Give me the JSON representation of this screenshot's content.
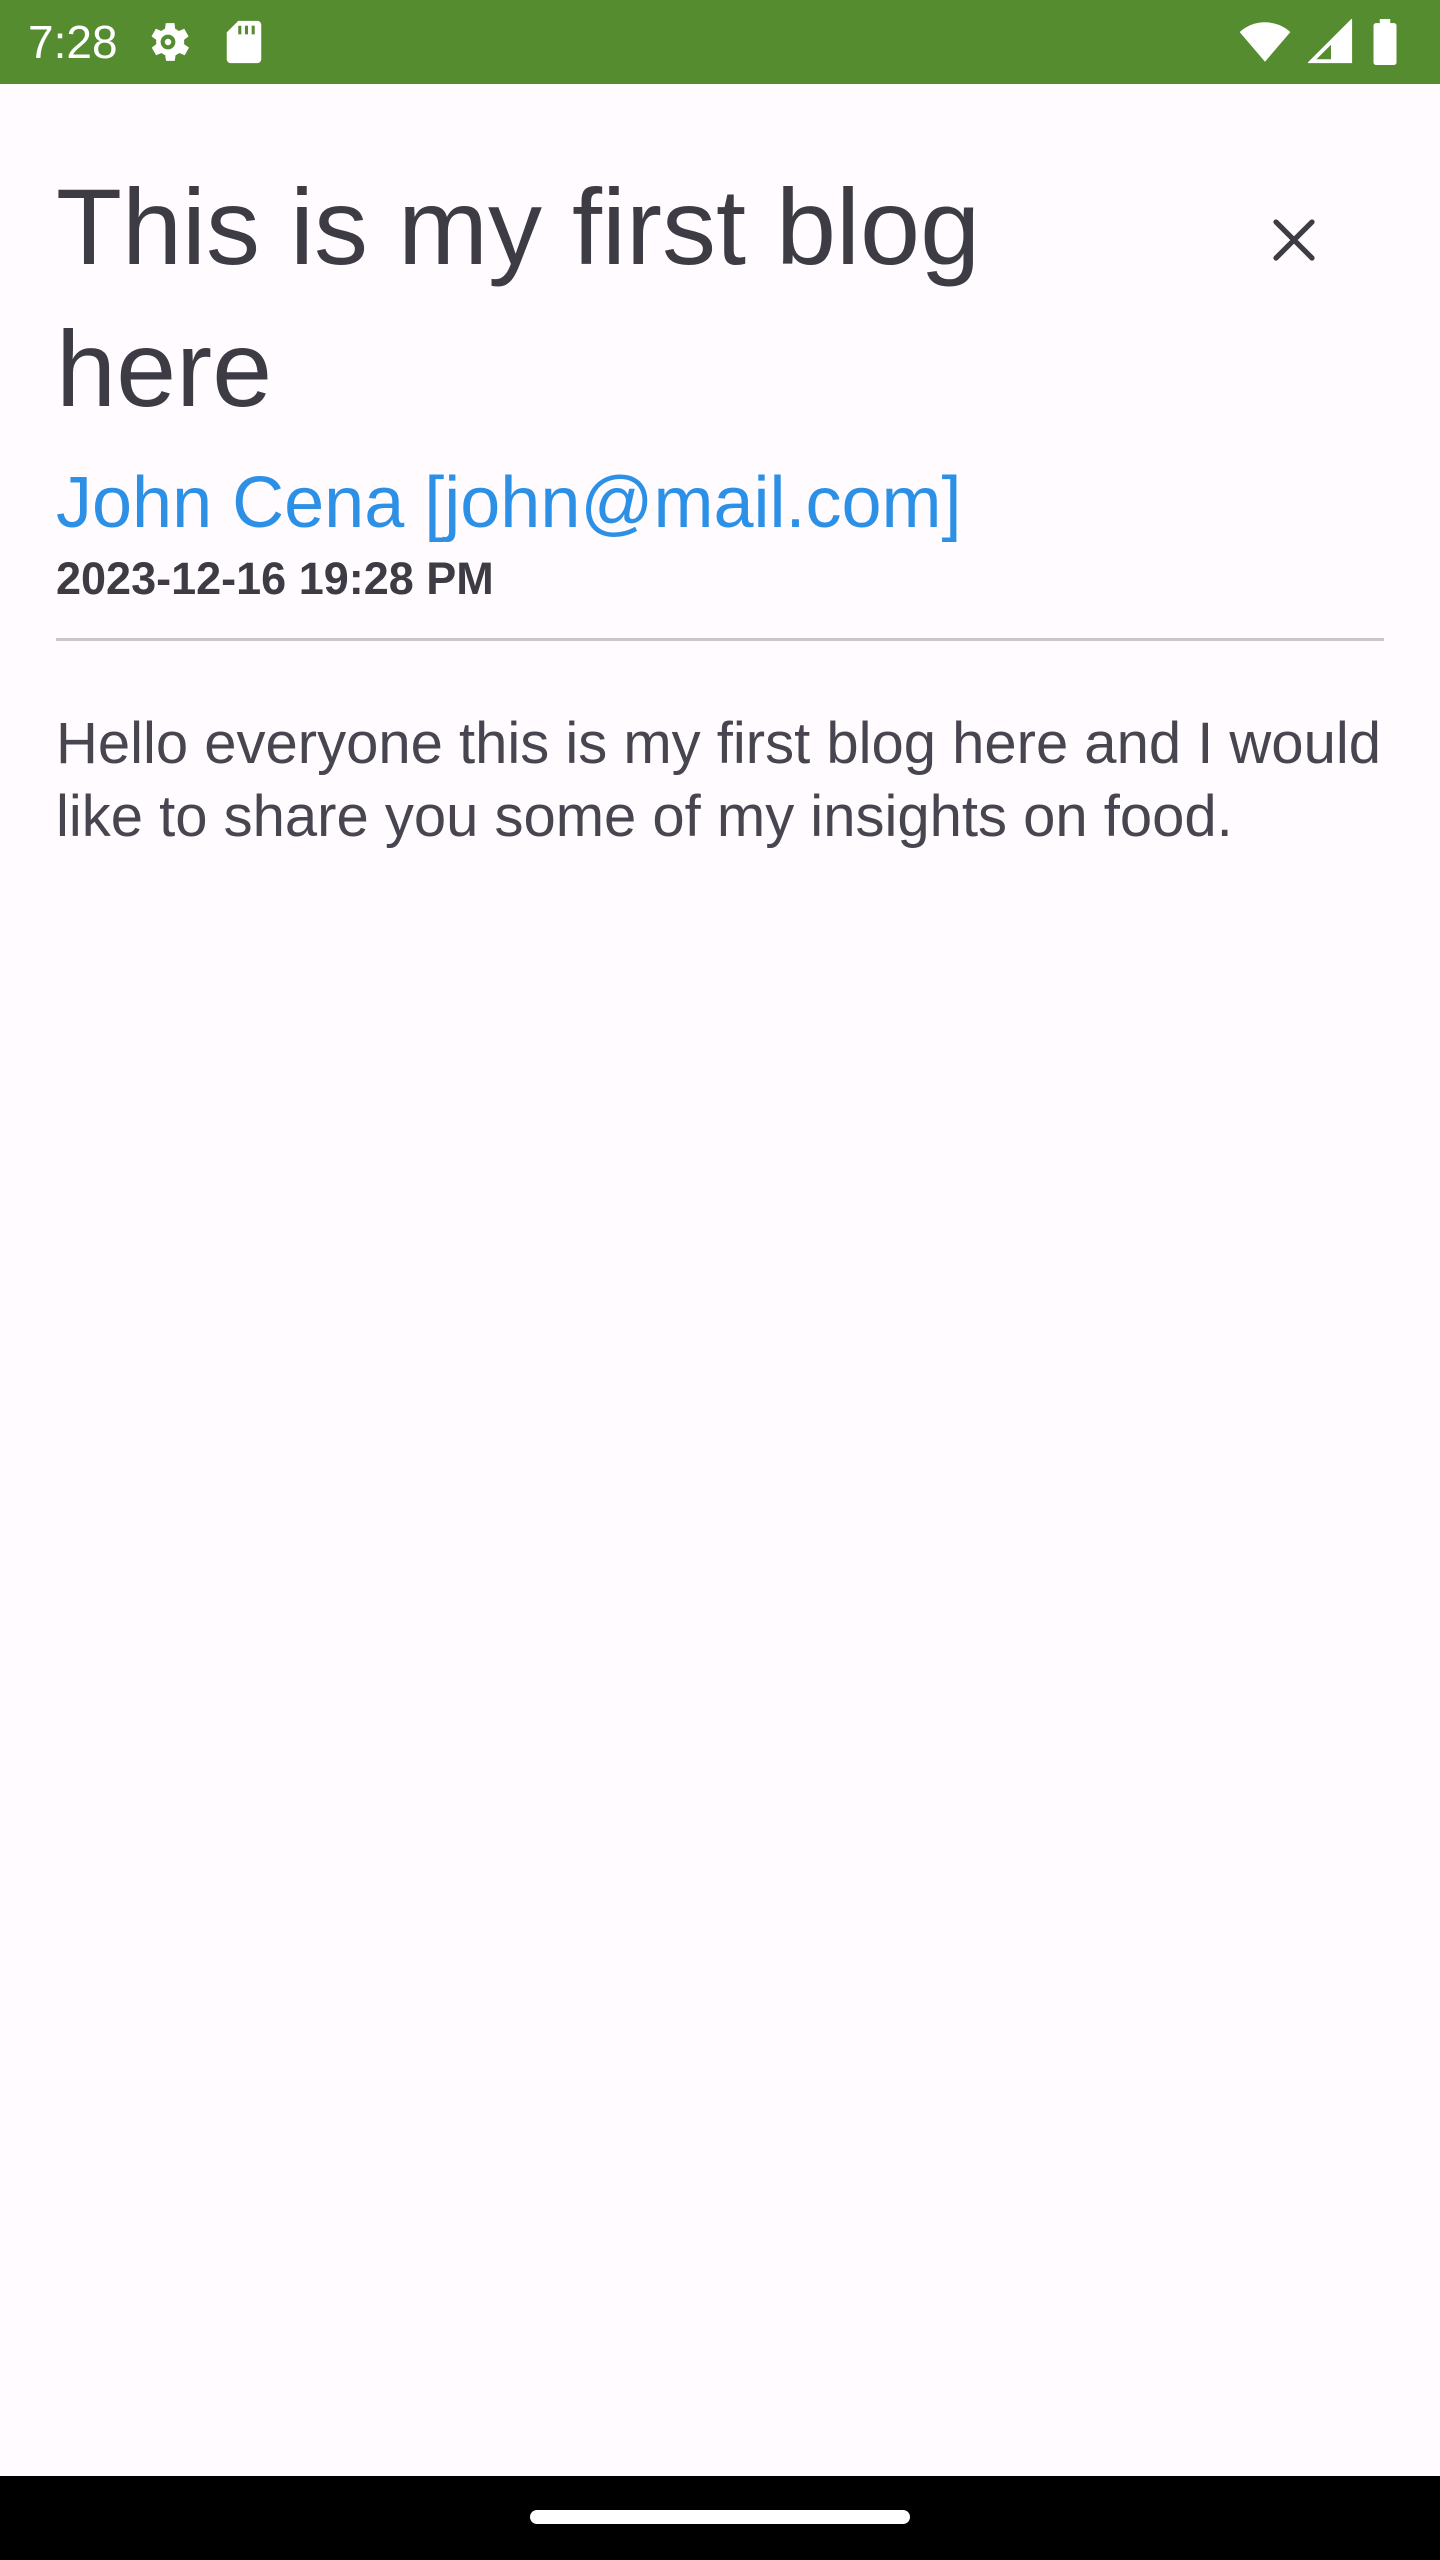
{
  "status_bar": {
    "time": "7:28",
    "background_color": "#548c2f",
    "left_icons": [
      "settings-gear-icon",
      "sd-card-icon"
    ],
    "right_icons": [
      "wifi-icon",
      "cell-signal-icon",
      "battery-icon"
    ]
  },
  "post": {
    "title": "This is my first blog here",
    "author": "John Cena [john@mail.com]",
    "date": "2023-12-16 19:28 PM",
    "body": "Hello everyone this is my first blog here and I would like to share you some of my insights on food."
  },
  "colors": {
    "author_link": "#2b90e6",
    "title_text": "#3d3c45",
    "page_background": "#fffbfe"
  },
  "actions": {
    "close_icon": "close-icon"
  }
}
